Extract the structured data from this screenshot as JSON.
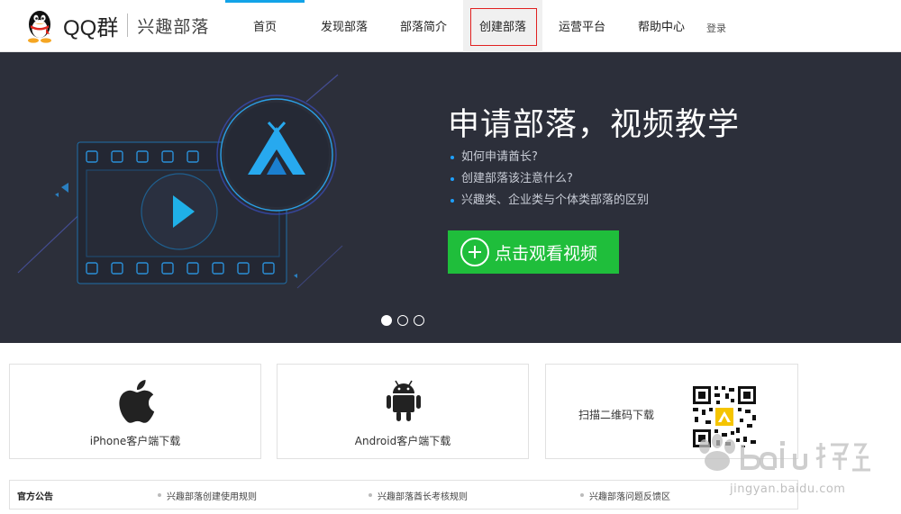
{
  "header": {
    "logo_text": "QQ群",
    "logo_sub": "兴趣部落",
    "nav": [
      {
        "label": "首页"
      },
      {
        "label": "发现部落"
      },
      {
        "label": "部落简介"
      },
      {
        "label": "创建部落"
      },
      {
        "label": "运营平台"
      },
      {
        "label": "帮助中心"
      }
    ],
    "login_label": "登录"
  },
  "banner": {
    "title": "申请部落，视频教学",
    "bullets": [
      "如何申请酋长?",
      "创建部落该注意什么?",
      "兴趣类、企业类与个体类部落的区别"
    ],
    "button_label": "点击观看视频",
    "slide_count": 3,
    "active_slide": 1
  },
  "downloads": {
    "iphone_label": "iPhone客户端下载",
    "android_label": "Android客户端下载",
    "qr_label": "扫描二维码下载"
  },
  "notice": {
    "title": "官方公告",
    "items": [
      "兴趣部落创建使用规则",
      "兴趣部落酋长考核规则",
      "兴趣部落问题反馈区"
    ]
  },
  "watermark": {
    "text": "jingyan.baidu.com"
  },
  "colors": {
    "accent_blue": "#12a3e8",
    "banner_bg": "#2c2f3a",
    "button_green": "#1fbe3b",
    "highlight_red": "#e02020"
  }
}
